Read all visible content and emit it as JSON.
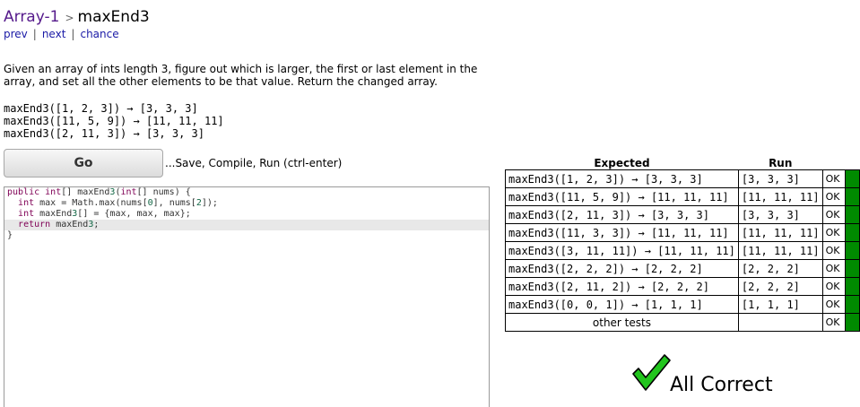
{
  "breadcrumb": {
    "section": "Array-1",
    "separator": ">",
    "problem": "maxEnd3"
  },
  "nav": {
    "prev": "prev",
    "divider": "|",
    "next": "next",
    "chance": "chance"
  },
  "description": "Given an array of ints length 3, figure out which is larger, the first or last element in the array, and set all the other elements to be that value. Return the changed array.",
  "examples": [
    "maxEnd3([1, 2, 3]) → [3, 3, 3]",
    "maxEnd3([11, 5, 9]) → [11, 11, 11]",
    "maxEnd3([2, 11, 3]) → [3, 3, 3]"
  ],
  "go_button": {
    "label": "Go",
    "hint": "...Save, Compile, Run (ctrl-enter)"
  },
  "editor": {
    "lines": [
      "public int[] maxEnd3(int[] nums) {",
      "  int max = Math.max(nums[0], nums[2]);",
      "  int maxEnd3[] = {max, max, max};",
      "  return maxEnd3;",
      "}"
    ],
    "active_line": 3
  },
  "results": {
    "headers": {
      "expected": "Expected",
      "run": "Run"
    },
    "rows": [
      {
        "expected": "maxEnd3([1, 2, 3]) → [3, 3, 3]",
        "run": "[3, 3, 3]",
        "status": "OK"
      },
      {
        "expected": "maxEnd3([11, 5, 9]) → [11, 11, 11]",
        "run": "[11, 11, 11]",
        "status": "OK"
      },
      {
        "expected": "maxEnd3([2, 11, 3]) → [3, 3, 3]",
        "run": "[3, 3, 3]",
        "status": "OK"
      },
      {
        "expected": "maxEnd3([11, 3, 3]) → [11, 11, 11]",
        "run": "[11, 11, 11]",
        "status": "OK"
      },
      {
        "expected": "maxEnd3([3, 11, 11]) → [11, 11, 11]",
        "run": "[11, 11, 11]",
        "status": "OK"
      },
      {
        "expected": "maxEnd3([2, 2, 2]) → [2, 2, 2]",
        "run": "[2, 2, 2]",
        "status": "OK"
      },
      {
        "expected": "maxEnd3([2, 11, 2]) → [2, 2, 2]",
        "run": "[2, 2, 2]",
        "status": "OK"
      },
      {
        "expected": "maxEnd3([0, 0, 1]) → [1, 1, 1]",
        "run": "[1, 1, 1]",
        "status": "OK"
      }
    ],
    "other_tests": {
      "label": "other tests",
      "run": "",
      "status": "OK"
    }
  },
  "summary": {
    "text": "All Correct",
    "icon": "checkmark-icon"
  },
  "colors": {
    "pass": "#008a00",
    "check": "#22c51e",
    "section_link": "#551a8b",
    "nav_link": "#1a1aa6"
  }
}
